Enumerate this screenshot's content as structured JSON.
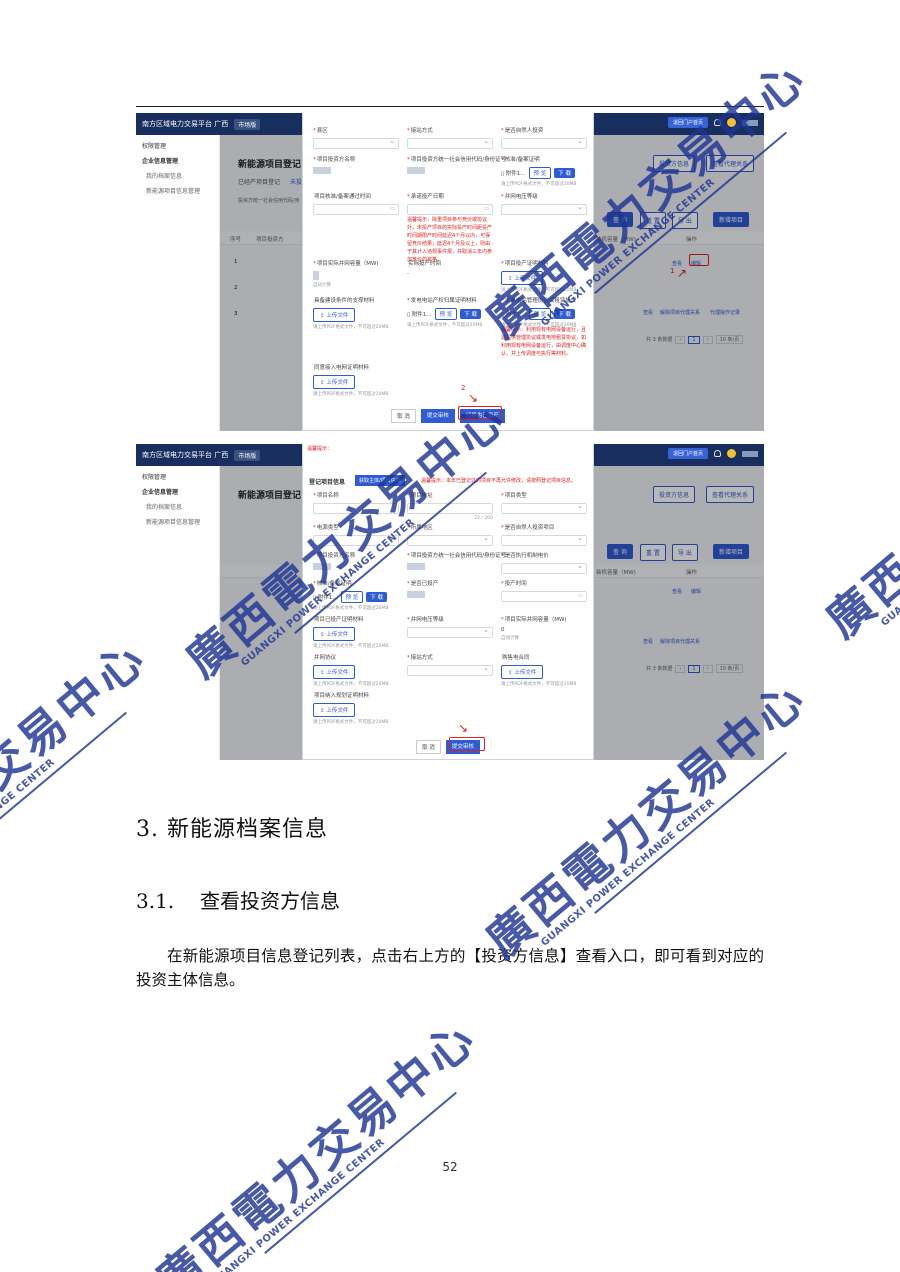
{
  "document": {
    "section_title": "3. 新能源档案信息",
    "subsection_number": "3.1.",
    "subsection_title": "查看投资方信息",
    "paragraph": "在新能源项目信息登记列表，点击右上方的【投资方信息】查看入口，即可看到对应的投资主体信息。",
    "page_number": "52"
  },
  "watermark": {
    "chinese": "廣西電力交易中心",
    "english": "GUANGXI POWER EXCHANGE CENTER",
    "color": "#1e3494"
  },
  "screenshot_1": {
    "app_title": "南方区域电力交易平台 广西",
    "city_badge": "市场版",
    "top_right_pill": "退回门户首页",
    "sidebar": {
      "home": "权限管理",
      "group": "企业信息管理",
      "item1": "我的档案信息",
      "item2": "新能源项目信息管理"
    },
    "page_title": "新能源项目登记",
    "tabs": [
      "已经产项目登记",
      "未投产"
    ],
    "filter_label": "投资方统一社会信用代码/身",
    "buttons": {
      "investor": "投资方信息",
      "agent": "查看代理关系",
      "query": "查 询",
      "reset": "重 置",
      "export": "导 出",
      "add": "新增项目"
    },
    "table_headers": {
      "seq": "序号",
      "name": "项目投资方",
      "capacity": "装机容量（MW)",
      "op": "操作"
    },
    "rows": [
      {
        "seq": "1",
        "ops": [
          "查看",
          "编辑"
        ]
      },
      {
        "seq": "2",
        "ops": []
      },
      {
        "seq": "3",
        "ops": [
          "查看",
          "解除项目代理关系",
          "代理操作记录"
        ]
      }
    ],
    "pager": {
      "total": "共 3 条数据",
      "page": "1",
      "size": "10 条/页"
    },
    "dialog": {
      "fields": {
        "region": "县区",
        "access": "接站方式",
        "natural_person": "是否自然人投资",
        "investor_name": "项目投资方名称",
        "investor_code": "项目投资方统一社会信用代码/身份证号",
        "approval_cert": "核准/备案证明",
        "approval_time": "项目核准/备案通过时间",
        "planned_date": "承诺投产日期",
        "grid_voltage": "并网电压等级",
        "actual_capacity": "项目实际并网容量（MW)",
        "actual_date": "实际投产时间",
        "commission_cert": "项目投产证明材料",
        "condition_material": "具备建设条件的支撑材料",
        "power_permit": "发电电站产权归属证明材料",
        "grid_contract": "发电电站管理协议或租赁协议",
        "grid_access": "同意接入电网证明材料"
      },
      "file_name": "附件1...",
      "preview": "预 览",
      "download": "下 载",
      "upload": "上传文件",
      "upload_hint": "请上传PDF格式文件，不可超过20MB",
      "calc_hint": "自动计算",
      "dash": "-",
      "note_1": "温馨提示：除重项目参与竞价或协议外，未投产项目的实际投产时间距投产时间期限产时间延迟4个月以内，可保留竞价结果；延迟4个月及以上，则由于其计入违规事件报，并取消三年内参加竞价的资格。",
      "note_2": "温馨提示：利用现有电网设备运行，且需提供管理协议或发电地租赁协议，如利用现有电网设备运行，由调度中心确认，并上传调度与执行等材料。",
      "cancel": "取 消",
      "submit": "提交审核",
      "convert": "切换为已投产",
      "marker_1": "1",
      "marker_2": "2"
    }
  },
  "screenshot_2": {
    "app_title": "南方区域电力交易平台 广西",
    "city_badge": "市场版",
    "top_right_pill": "退回门户首页",
    "top_warning": "温馨提示：",
    "section_label": "登记项目信息",
    "tag_button": "获取主体/项目信息",
    "warning": "温馨提示：本年已登记过的项目不再允许修改，请按照登记项目信息。",
    "fields": {
      "project_name": "项目名称",
      "project_addr": "项目地址",
      "project_type": "项目类型",
      "power_type": "电源类型",
      "location": "所属地区",
      "natural_person": "是否自然人投资项目",
      "investor_name": "项目投资方名称",
      "investor_code": "项目投资方统一社会信用代码/身份证号",
      "exec_price": "是否执行机制电价",
      "approval_cert": "核准/备案证明",
      "commissioned": "是否已投产",
      "commission_time": "投产时间",
      "commission_cert": "项目已投产证明材料",
      "grid_voltage": "并网电压等级",
      "actual_capacity": "项目实际并网容量（MW)",
      "grid_agreement": "并网协议",
      "access": "接站方式",
      "purchase_contract": "购售电合同",
      "planning_material": "项目纳入规划证明材料"
    },
    "char_count": "22 / 200",
    "capacity_value": "0",
    "calc_hint": "自动计算",
    "file_name": "附件1...",
    "preview": "预 览",
    "download": "下 载",
    "upload": "上传文件",
    "upload_hint": "请上传PDF格式文件，不可超过20MB",
    "cancel": "取 消",
    "submit": "提交审核"
  }
}
